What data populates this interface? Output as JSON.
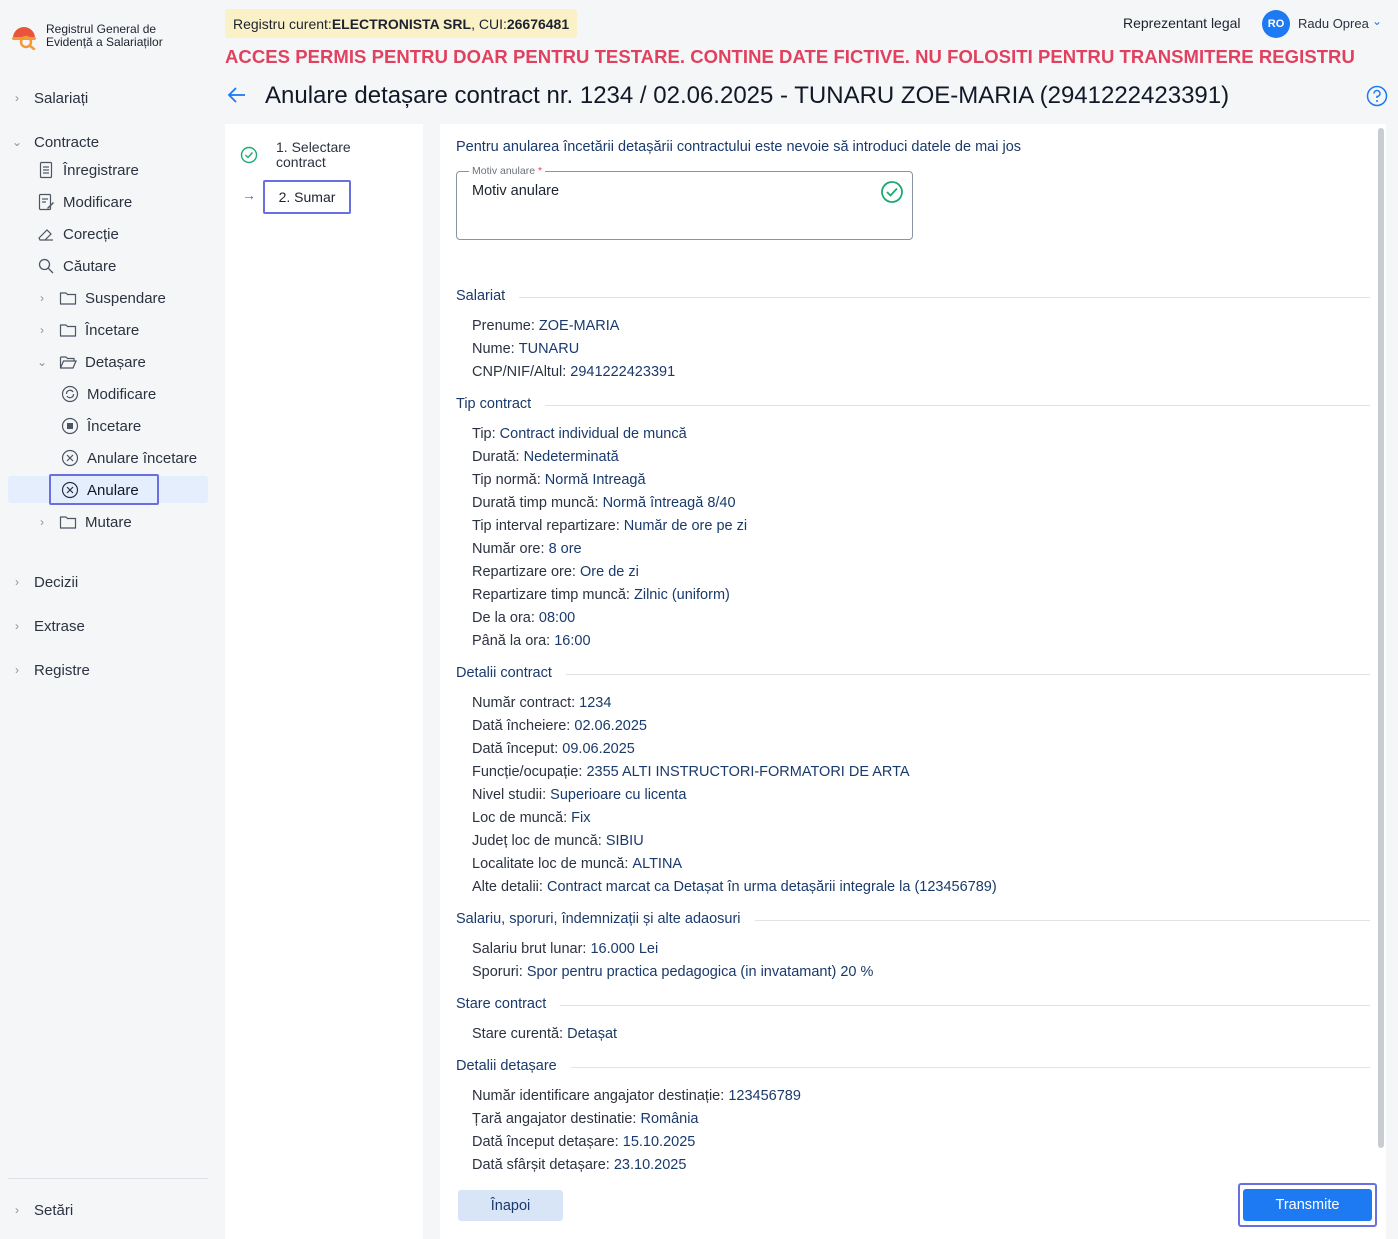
{
  "app": {
    "logo_line1": "Registrul General de",
    "logo_line2": "Evidență a Salariaților"
  },
  "header": {
    "registry_prefix": "Registru curent: ",
    "registry_company": "ELECTRONISTA SRL",
    "registry_cui_prefix": ", CUI: ",
    "registry_cui": "26676481",
    "warning": "ACCES PERMIS PENTRU DOAR PENTRU TESTARE. CONTINE DATE FICTIVE. NU FOLOSITI PENTRU TRANSMITERE REGISTRU",
    "role": "Reprezentant legal",
    "avatar_initials": "RO",
    "user_name": "Radu Oprea"
  },
  "sidebar": {
    "salariati": "Salariați",
    "contracte": "Contracte",
    "inregistrare": "Înregistrare",
    "modificare": "Modificare",
    "corectie": "Corecție",
    "cautare": "Căutare",
    "suspendare": "Suspendare",
    "incetare": "Încetare",
    "detasare": "Detașare",
    "detasare_modificare": "Modificare",
    "detasare_incetare": "Încetare",
    "detasare_anulare_incetare": "Anulare încetare",
    "detasare_anulare": "Anulare",
    "mutare": "Mutare",
    "decizii": "Decizii",
    "extrase": "Extrase",
    "registre": "Registre",
    "setari": "Setări"
  },
  "page": {
    "title": "Anulare detașare contract nr. 1234 / 02.06.2025 - TUNARU ZOE-MARIA (2941222423391)"
  },
  "steps": {
    "step1_line1": "1. Selectare",
    "step1_line2": "contract",
    "step2": "2. Sumar"
  },
  "form": {
    "intro": "Pentru anularea încetării detașării contractului este nevoie să introduci datele de mai jos",
    "motiv_label": "Motiv anulare",
    "motiv_required": "*",
    "motiv_value": "Motiv anulare"
  },
  "summary": {
    "salariat": {
      "title": "Salariat",
      "prenume_k": "Prenume: ",
      "prenume_v": "ZOE-MARIA",
      "nume_k": "Nume: ",
      "nume_v": "TUNARU",
      "cnp_k": "CNP/NIF/Altul: ",
      "cnp_v": "2941222423391"
    },
    "tip_contract": {
      "title": "Tip contract",
      "tip_k": "Tip: ",
      "tip_v": "Contract individual de muncă",
      "durata_k": "Durată: ",
      "durata_v": "Nedeterminată",
      "norma_k": "Tip normă: ",
      "norma_v": "Normă Intreagă",
      "timp_k": "Durată timp muncă: ",
      "timp_v": "Normă întreagă 8/40",
      "interval_k": "Tip interval repartizare: ",
      "interval_v": "Număr de ore pe zi",
      "ore_k": "Număr ore: ",
      "ore_v": "8 ore",
      "rep_ore_k": "Repartizare ore: ",
      "rep_ore_v": "Ore de zi",
      "rep_timp_k": "Repartizare timp muncă: ",
      "rep_timp_v": "Zilnic (uniform)",
      "de_la_k": "De la ora: ",
      "de_la_v": "08:00",
      "pana_k": "Până la ora: ",
      "pana_v": "16:00"
    },
    "detalii_contract": {
      "title": "Detalii contract",
      "nr_k": "Număr contract: ",
      "nr_v": "1234",
      "incheiere_k": "Dată încheiere: ",
      "incheiere_v": "02.06.2025",
      "inceput_k": "Dată început: ",
      "inceput_v": "09.06.2025",
      "functie_k": "Funcție/ocupație: ",
      "functie_v": "2355 ALTI INSTRUCTORI-FORMATORI DE ARTA",
      "studii_k": "Nivel studii: ",
      "studii_v": "Superioare cu licenta",
      "loc_k": "Loc de muncă: ",
      "loc_v": "Fix",
      "judet_k": "Județ loc de muncă: ",
      "judet_v": "SIBIU",
      "localitate_k": "Localitate loc de muncă: ",
      "localitate_v": "ALTINA",
      "alte_k": "Alte detalii: ",
      "alte_v": "Contract marcat ca Detașat în urma detașării integrale la (123456789)"
    },
    "salariu": {
      "title": "Salariu, sporuri, îndemnizații și alte adaosuri",
      "brut_k": "Salariu brut lunar: ",
      "brut_v": "16.000 Lei",
      "sporuri_k": "Sporuri: ",
      "sporuri_v": "Spor pentru practica pedagogica (in invatamant) 20 %"
    },
    "stare": {
      "title": "Stare contract",
      "curenta_k": "Stare curentă: ",
      "curenta_v": "Detașat"
    },
    "detasare": {
      "title": "Detalii detașare",
      "id_k": "Număr identificare angajator destinație: ",
      "id_v": "123456789",
      "tara_k": "Țară angajator destinatie: ",
      "tara_v": "România",
      "inceput_k": "Dată început detașare: ",
      "inceput_v": "15.10.2025",
      "sfarsit_k": "Dată sfârșit detașare: ",
      "sfarsit_v": "23.10.2025"
    }
  },
  "actions": {
    "back": "Înapoi",
    "submit": "Transmite"
  },
  "colors": {
    "accent": "#1d7af3",
    "warning": "#e0415f",
    "focus": "#6a6fe0",
    "success": "#1fa971"
  }
}
